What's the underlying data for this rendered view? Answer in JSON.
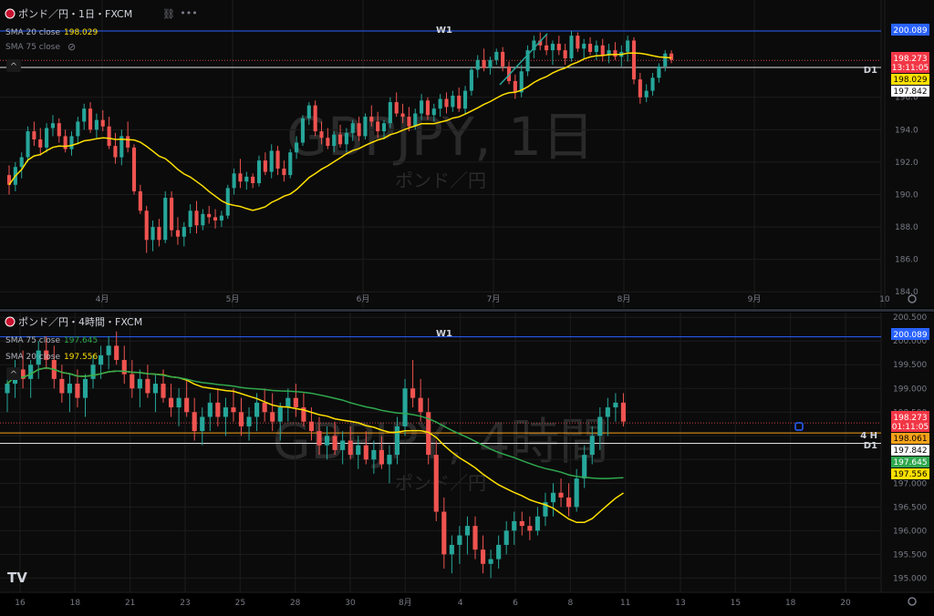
{
  "colors": {
    "background": "#0b0b0b",
    "grid": "#1c1c1c",
    "up": "#26a69a",
    "down": "#ef5350",
    "sma20": "#ffe000",
    "sma75": "#2fa84f",
    "w1_line": "#2962ff",
    "price_line": "#e0e0e0",
    "text": "#d1d4dc",
    "dim_text": "#787b86",
    "watermark": "#2a2a2a"
  },
  "top_panel": {
    "header": {
      "symbol": "ポンド／円・1日・FXCM",
      "ind1_label": "SMA 20 close",
      "ind1_value": "198.029",
      "ind2_label": "SMA 75 close"
    },
    "watermark": {
      "title": "GBPJPY, 1日",
      "subtitle": "ポンド／円"
    },
    "w1_label": "W1",
    "d1_label": "D1",
    "price_badges": {
      "w1": "200.089",
      "last": "198.273",
      "countdown": "13:11:05",
      "sma20": "198.029",
      "d1": "197.842"
    }
  },
  "bottom_panel": {
    "header": {
      "symbol": "ポンド／円・4時間・FXCM",
      "ind1_label": "SMA 75 close",
      "ind1_value": "197.645",
      "ind2_label": "SMA 20 close",
      "ind2_value": "197.556"
    },
    "watermark": {
      "title": "GBPJPY, 4時間",
      "subtitle": "ポンド／円"
    },
    "w1_label": "W1",
    "h4_label": "4 H",
    "d1_label": "D1",
    "price_badges": {
      "w1": "200.089",
      "last": "198.273",
      "countdown": "01:11:05",
      "h4": "198.061",
      "d1": "197.842",
      "sma75": "197.645",
      "sma20": "197.556"
    },
    "logo": "TV"
  },
  "chart_data": [
    {
      "type": "candlestick",
      "title": "GBPJPY, 1日",
      "timeframe": "1日",
      "ylim": [
        183,
        202
      ],
      "y_ticks": [
        184.0,
        186.0,
        188.0,
        190.0,
        192.0,
        194.0,
        196.0
      ],
      "x_tick_labels": [
        "4月",
        "5月",
        "6月",
        "7月",
        "8月",
        "9月",
        "10"
      ],
      "series": [
        {
          "name": "SMA 20 close",
          "last_value": 198.029
        },
        {
          "name": "SMA 75 close"
        }
      ],
      "levels": {
        "W1": 200.089,
        "D1": 197.842,
        "last": 198.273
      },
      "candles": [
        [
          191.2,
          191.8,
          190.0,
          190.6
        ],
        [
          190.6,
          192.0,
          190.2,
          191.7
        ],
        [
          191.7,
          192.6,
          191.0,
          192.3
        ],
        [
          192.3,
          194.2,
          192.0,
          193.9
        ],
        [
          193.9,
          194.5,
          193.0,
          193.4
        ],
        [
          193.4,
          194.1,
          192.4,
          192.9
        ],
        [
          192.9,
          194.4,
          192.6,
          194.1
        ],
        [
          194.1,
          194.9,
          193.6,
          194.4
        ],
        [
          194.4,
          194.7,
          193.2,
          193.6
        ],
        [
          193.6,
          194.0,
          192.6,
          192.8
        ],
        [
          192.8,
          193.9,
          192.4,
          193.6
        ],
        [
          193.6,
          194.8,
          193.1,
          194.5
        ],
        [
          194.5,
          195.6,
          194.0,
          195.3
        ],
        [
          195.3,
          195.7,
          193.8,
          194.0
        ],
        [
          194.0,
          195.0,
          193.5,
          194.6
        ],
        [
          194.6,
          195.2,
          193.9,
          194.2
        ],
        [
          194.2,
          194.8,
          192.8,
          193.0
        ],
        [
          193.0,
          193.8,
          191.9,
          192.3
        ],
        [
          192.3,
          194.0,
          191.8,
          193.6
        ],
        [
          193.6,
          194.5,
          192.6,
          192.9
        ],
        [
          192.9,
          193.1,
          190.0,
          190.2
        ],
        [
          190.2,
          190.6,
          188.8,
          189.0
        ],
        [
          189.0,
          189.3,
          186.4,
          187.2
        ],
        [
          187.2,
          188.4,
          186.5,
          188.0
        ],
        [
          188.0,
          188.5,
          186.8,
          187.2
        ],
        [
          187.2,
          190.2,
          187.0,
          189.8
        ],
        [
          189.8,
          190.2,
          187.4,
          187.8
        ],
        [
          187.8,
          188.6,
          186.9,
          187.4
        ],
        [
          187.4,
          188.3,
          186.8,
          188.0
        ],
        [
          188.0,
          189.4,
          187.6,
          189.0
        ],
        [
          189.0,
          189.6,
          187.6,
          188.1
        ],
        [
          188.1,
          189.1,
          187.8,
          188.8
        ],
        [
          188.8,
          189.3,
          188.2,
          188.6
        ],
        [
          188.6,
          189.1,
          187.9,
          188.4
        ],
        [
          188.4,
          189.0,
          188.0,
          188.7
        ],
        [
          188.7,
          190.6,
          188.5,
          190.4
        ],
        [
          190.4,
          191.6,
          190.0,
          191.3
        ],
        [
          191.3,
          192.2,
          190.4,
          190.8
        ],
        [
          190.8,
          191.4,
          190.3,
          191.1
        ],
        [
          191.1,
          191.3,
          190.4,
          190.7
        ],
        [
          190.7,
          192.4,
          190.5,
          192.1
        ],
        [
          192.1,
          192.6,
          191.2,
          191.4
        ],
        [
          191.4,
          193.1,
          191.0,
          192.7
        ],
        [
          192.7,
          193.0,
          191.2,
          191.6
        ],
        [
          191.6,
          192.1,
          190.8,
          191.2
        ],
        [
          191.2,
          192.8,
          191.0,
          192.6
        ],
        [
          192.6,
          193.6,
          192.2,
          193.2
        ],
        [
          193.2,
          194.9,
          193.0,
          194.7
        ],
        [
          194.7,
          195.7,
          194.3,
          195.5
        ],
        [
          195.5,
          195.8,
          193.6,
          193.9
        ],
        [
          193.9,
          194.5,
          193.1,
          193.5
        ],
        [
          193.5,
          194.1,
          192.8,
          193.0
        ],
        [
          193.0,
          193.9,
          192.6,
          193.7
        ],
        [
          193.7,
          194.3,
          192.9,
          193.1
        ],
        [
          193.1,
          194.1,
          192.6,
          193.8
        ],
        [
          193.8,
          194.6,
          193.3,
          194.4
        ],
        [
          194.4,
          194.8,
          193.3,
          193.6
        ],
        [
          193.6,
          195.0,
          193.4,
          194.8
        ],
        [
          194.8,
          195.5,
          194.2,
          194.5
        ],
        [
          194.5,
          195.1,
          193.5,
          193.9
        ],
        [
          193.9,
          194.6,
          193.4,
          194.4
        ],
        [
          194.4,
          196.0,
          194.1,
          195.7
        ],
        [
          195.7,
          196.3,
          194.8,
          195.0
        ],
        [
          195.0,
          195.6,
          194.4,
          194.8
        ],
        [
          194.8,
          195.4,
          193.9,
          194.2
        ],
        [
          194.2,
          195.3,
          194.0,
          195.0
        ],
        [
          195.0,
          196.2,
          194.6,
          195.8
        ],
        [
          195.8,
          196.0,
          194.6,
          194.9
        ],
        [
          194.9,
          195.6,
          194.5,
          195.3
        ],
        [
          195.3,
          196.2,
          194.8,
          195.9
        ],
        [
          195.9,
          196.3,
          195.0,
          195.4
        ],
        [
          195.4,
          196.4,
          195.1,
          196.1
        ],
        [
          196.1,
          196.6,
          195.1,
          195.3
        ],
        [
          195.3,
          196.7,
          195.0,
          196.4
        ],
        [
          196.4,
          197.9,
          196.1,
          197.7
        ],
        [
          197.7,
          198.6,
          197.2,
          198.3
        ],
        [
          198.3,
          199.0,
          197.6,
          197.8
        ],
        [
          197.8,
          198.5,
          197.4,
          198.3
        ],
        [
          198.3,
          199.0,
          198.0,
          198.8
        ],
        [
          198.8,
          199.1,
          197.6,
          197.9
        ],
        [
          197.9,
          198.2,
          196.8,
          197.0
        ],
        [
          197.0,
          197.4,
          195.9,
          196.3
        ],
        [
          196.3,
          198.0,
          196.0,
          197.6
        ],
        [
          197.6,
          199.2,
          197.3,
          198.9
        ],
        [
          198.9,
          199.8,
          198.4,
          199.5
        ],
        [
          199.5,
          200.0,
          198.9,
          199.2
        ],
        [
          199.2,
          199.9,
          198.6,
          198.9
        ],
        [
          198.9,
          199.5,
          198.0,
          199.3
        ],
        [
          199.3,
          199.8,
          198.6,
          198.9
        ],
        [
          198.9,
          199.3,
          198.0,
          198.4
        ],
        [
          198.4,
          200.1,
          198.2,
          199.8
        ],
        [
          199.8,
          200.0,
          198.8,
          199.0
        ],
        [
          199.0,
          199.6,
          198.4,
          199.3
        ],
        [
          199.3,
          199.7,
          198.6,
          198.8
        ],
        [
          198.8,
          199.5,
          198.3,
          199.2
        ],
        [
          199.2,
          199.6,
          198.2,
          198.6
        ],
        [
          198.6,
          199.3,
          198.1,
          198.9
        ],
        [
          198.9,
          199.4,
          198.3,
          198.5
        ],
        [
          198.5,
          199.2,
          197.9,
          198.8
        ],
        [
          198.8,
          199.8,
          198.2,
          199.5
        ],
        [
          199.5,
          199.7,
          196.8,
          197.1
        ],
        [
          197.1,
          197.5,
          195.6,
          196.0
        ],
        [
          196.0,
          196.8,
          195.7,
          196.4
        ],
        [
          196.4,
          197.5,
          196.1,
          197.2
        ],
        [
          197.2,
          198.1,
          196.9,
          197.9
        ],
        [
          197.9,
          198.9,
          197.6,
          198.7
        ],
        [
          198.7,
          198.9,
          198.1,
          198.3
        ]
      ]
    },
    {
      "type": "candlestick",
      "title": "GBPJPY, 4時間",
      "timeframe": "4時間",
      "ylim": [
        194.7,
        200.6
      ],
      "y_ticks": [
        195.0,
        195.5,
        196.0,
        196.5,
        197.0,
        197.5,
        198.0,
        198.5,
        199.0,
        199.5,
        200.0,
        200.5
      ],
      "x_tick_labels": [
        "16",
        "18",
        "21",
        "23",
        "25",
        "28",
        "30",
        "8月",
        "4",
        "6",
        "8",
        "11",
        "13",
        "15",
        "18",
        "20"
      ],
      "series": [
        {
          "name": "SMA 75 close",
          "last_value": 197.645
        },
        {
          "name": "SMA 20 close",
          "last_value": 197.556
        }
      ],
      "levels": {
        "W1": 200.089,
        "4H": 198.061,
        "D1": 197.842,
        "last": 198.273
      },
      "candles": [
        [
          198.9,
          199.3,
          198.5,
          199.1
        ],
        [
          199.1,
          199.6,
          198.8,
          199.4
        ],
        [
          199.4,
          199.8,
          199.0,
          199.2
        ],
        [
          199.2,
          199.6,
          198.8,
          199.5
        ],
        [
          199.5,
          200.0,
          199.2,
          199.8
        ],
        [
          199.8,
          200.1,
          199.4,
          199.6
        ],
        [
          199.6,
          199.9,
          199.0,
          199.2
        ],
        [
          199.2,
          199.5,
          198.7,
          198.9
        ],
        [
          198.9,
          199.3,
          198.5,
          199.1
        ],
        [
          199.1,
          199.4,
          198.6,
          198.8
        ],
        [
          198.8,
          199.3,
          198.4,
          199.2
        ],
        [
          199.2,
          199.7,
          199.0,
          199.5
        ],
        [
          199.5,
          199.9,
          199.2,
          199.7
        ],
        [
          199.7,
          200.1,
          199.4,
          199.9
        ],
        [
          199.9,
          200.2,
          199.5,
          199.6
        ],
        [
          199.6,
          199.9,
          199.1,
          199.3
        ],
        [
          199.3,
          199.6,
          198.8,
          199.0
        ],
        [
          199.0,
          199.4,
          198.6,
          199.2
        ],
        [
          199.2,
          199.5,
          198.8,
          198.9
        ],
        [
          198.9,
          199.3,
          198.5,
          199.1
        ],
        [
          199.1,
          199.4,
          198.7,
          198.8
        ],
        [
          198.8,
          199.1,
          198.4,
          198.6
        ],
        [
          198.6,
          199.0,
          198.2,
          198.8
        ],
        [
          198.8,
          199.2,
          198.4,
          198.5
        ],
        [
          198.5,
          198.8,
          197.9,
          198.1
        ],
        [
          198.1,
          198.6,
          197.8,
          198.4
        ],
        [
          198.4,
          198.9,
          198.1,
          198.7
        ],
        [
          198.7,
          199.0,
          198.2,
          198.4
        ],
        [
          198.4,
          198.8,
          198.0,
          198.6
        ],
        [
          198.6,
          199.0,
          198.3,
          198.5
        ],
        [
          198.5,
          198.8,
          198.0,
          198.2
        ],
        [
          198.2,
          198.6,
          197.9,
          198.4
        ],
        [
          198.4,
          198.9,
          198.1,
          198.7
        ],
        [
          198.7,
          199.0,
          198.3,
          198.5
        ],
        [
          198.5,
          198.9,
          198.1,
          198.3
        ],
        [
          198.3,
          198.7,
          197.9,
          198.6
        ],
        [
          198.6,
          199.0,
          198.3,
          198.8
        ],
        [
          198.8,
          199.1,
          198.4,
          198.6
        ],
        [
          198.6,
          198.9,
          198.2,
          198.3
        ],
        [
          198.3,
          198.6,
          197.9,
          198.1
        ],
        [
          198.1,
          198.4,
          197.6,
          197.8
        ],
        [
          197.8,
          198.2,
          197.5,
          198.0
        ],
        [
          198.0,
          198.3,
          197.6,
          197.7
        ],
        [
          197.7,
          198.1,
          197.4,
          197.9
        ],
        [
          197.9,
          198.2,
          197.5,
          197.6
        ],
        [
          197.6,
          198.0,
          197.3,
          197.8
        ],
        [
          197.8,
          198.1,
          197.4,
          197.5
        ],
        [
          197.5,
          197.9,
          197.2,
          197.7
        ],
        [
          197.7,
          198.0,
          197.3,
          197.4
        ],
        [
          197.4,
          197.8,
          197.0,
          197.6
        ],
        [
          197.6,
          198.4,
          197.4,
          198.2
        ],
        [
          198.2,
          199.2,
          198.0,
          199.0
        ],
        [
          199.0,
          199.6,
          198.6,
          198.8
        ],
        [
          198.8,
          199.2,
          198.3,
          198.5
        ],
        [
          198.5,
          198.8,
          197.4,
          197.6
        ],
        [
          197.6,
          197.9,
          196.2,
          196.4
        ],
        [
          196.4,
          196.7,
          195.2,
          195.5
        ],
        [
          195.5,
          195.9,
          195.1,
          195.7
        ],
        [
          195.7,
          196.1,
          195.3,
          195.9
        ],
        [
          195.9,
          196.3,
          195.5,
          196.1
        ],
        [
          196.1,
          196.3,
          195.4,
          195.6
        ],
        [
          195.6,
          195.9,
          195.1,
          195.3
        ],
        [
          195.3,
          195.6,
          195.0,
          195.4
        ],
        [
          195.4,
          195.9,
          195.2,
          195.7
        ],
        [
          195.7,
          196.2,
          195.5,
          196.0
        ],
        [
          196.0,
          196.4,
          195.7,
          196.2
        ],
        [
          196.2,
          196.4,
          195.9,
          196.1
        ],
        [
          196.1,
          196.3,
          195.8,
          196.0
        ],
        [
          196.0,
          196.5,
          195.9,
          196.3
        ],
        [
          196.3,
          196.8,
          196.1,
          196.6
        ],
        [
          196.6,
          197.0,
          196.3,
          196.8
        ],
        [
          196.8,
          197.1,
          196.5,
          196.7
        ],
        [
          196.7,
          197.0,
          196.3,
          196.5
        ],
        [
          196.5,
          197.3,
          196.4,
          197.1
        ],
        [
          197.1,
          197.8,
          196.9,
          197.6
        ],
        [
          197.6,
          198.2,
          197.4,
          198.0
        ],
        [
          198.0,
          198.6,
          197.7,
          198.4
        ],
        [
          198.4,
          198.8,
          198.0,
          198.6
        ],
        [
          198.6,
          198.9,
          198.3,
          198.7
        ],
        [
          198.7,
          198.9,
          198.2,
          198.3
        ]
      ]
    }
  ]
}
